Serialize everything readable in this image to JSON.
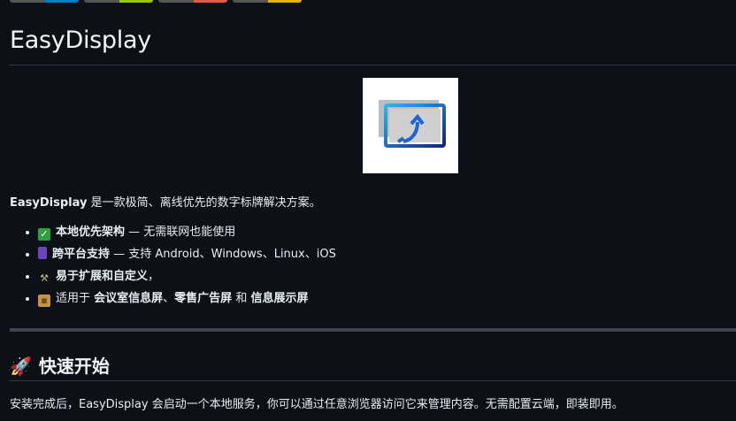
{
  "badges": [
    {
      "name": "badge-1",
      "color": "#007ec6"
    },
    {
      "name": "badge-2",
      "color": "#97ca00"
    },
    {
      "name": "badge-3",
      "color": "#e05d44"
    },
    {
      "name": "badge-4",
      "color": "#dfb317"
    }
  ],
  "title": "EasyDisplay",
  "intro": {
    "brand": "EasyDisplay",
    "text": " 是一款极简、离线优先的数字标牌解决方案。"
  },
  "features": [
    {
      "icon": "check-mark-icon",
      "bold": "本地优先架构",
      "rest": " — 无需联网也能使用"
    },
    {
      "icon": "mobile-phone-icon",
      "bold": "跨平台支持",
      "rest": " — 支持 Android、Windows、Linux、iOS"
    },
    {
      "icon": "tools-icon",
      "bold": "易于扩展和自定义",
      "rest": "，"
    },
    {
      "icon": "package-icon",
      "pre": "适用于 ",
      "bold1": "会议室信息屏",
      "sep1": "、",
      "bold2": "零售广告屏",
      "sep2": " 和 ",
      "bold3": "信息展示屏"
    }
  ],
  "quickstart": {
    "icon": "rocket-icon",
    "heading": "快速开始",
    "paragraph": "安装完成后，EasyDisplay 会启动一个本地服务，你可以通过任意浏览器访问它来管理内容。无需配置云端，即装即用。"
  }
}
